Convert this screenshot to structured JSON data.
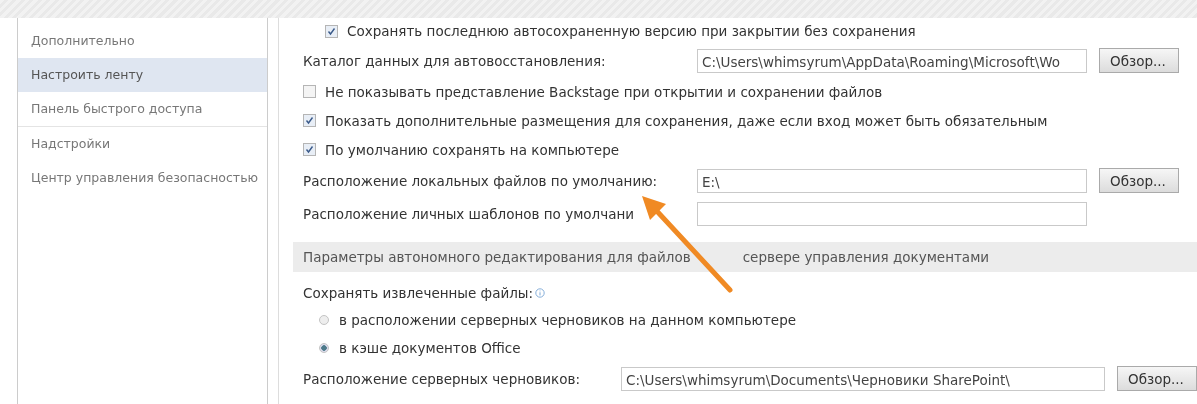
{
  "sidebar": {
    "items": [
      {
        "label": "Дополнительно",
        "selected": false
      },
      {
        "label": "Настроить ленту",
        "selected": true
      },
      {
        "label": "Панель быстрого доступа",
        "selected": false
      },
      {
        "label": "Надстройки",
        "selected": false
      },
      {
        "label": "Центр управления безопасностью",
        "selected": false
      }
    ]
  },
  "options": [
    {
      "kind": "checkbox",
      "label": "Сохранять последнюю автосохраненную версию при закрытии без сохранения",
      "checked": true,
      "indent": true
    },
    {
      "kind": "path",
      "label": "Каталог данных для автовосстановления:",
      "value": "C:\\Users\\whimsyrum\\AppData\\Roaming\\Microsoft\\Wo",
      "button": "Обзор..."
    },
    {
      "kind": "checkbox",
      "label": "Не показывать представление Backstage при открытии и сохранении файлов",
      "checked": false
    },
    {
      "kind": "checkbox",
      "label": "Показать дополнительные размещения для сохранения, даже если вход может быть обязательным",
      "checked": true
    },
    {
      "kind": "checkbox",
      "label": "По умолчанию сохранять на компьютере",
      "checked": true
    },
    {
      "kind": "path",
      "label": "Расположение локальных файлов по умолчанию:",
      "value": "E:\\",
      "button": "Обзор..."
    },
    {
      "kind": "path",
      "label": "Расположение личных шаблонов по умолчани"
    }
  ],
  "section": {
    "title_parts": [
      "Параметры автономного редактирования для файлов",
      "сервере управления документами"
    ]
  },
  "offline": [
    {
      "kind": "label",
      "label": "Сохранять извлеченные файлы:"
    },
    {
      "kind": "radio",
      "label": "в расположении серверных черновиков на данном компьютере",
      "selected": false
    },
    {
      "kind": "radio",
      "label": "в кэше документов Office",
      "selected": true
    },
    {
      "kind": "path",
      "label": "Расположение серверных черновиков:",
      "value": "C:\\Users\\whimsyrum\\Documents\\Черновики SharePoint\\",
      "button": "Обзор...",
      "short": true
    }
  ]
}
